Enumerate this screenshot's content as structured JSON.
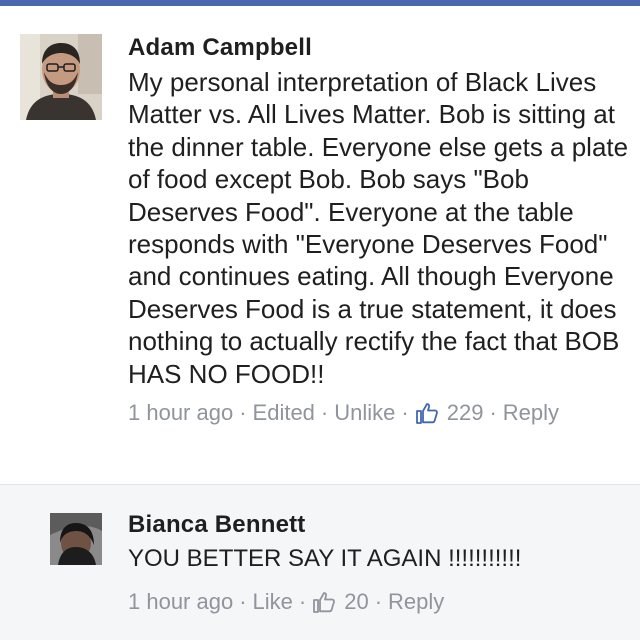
{
  "comments": [
    {
      "author": "Adam Campbell",
      "text": "My personal interpretation of Black Lives Matter vs. All Lives Matter. Bob is sitting at the dinner table. Everyone else gets a plate of food except Bob. Bob says \"Bob Deserves Food\". Everyone at the table responds with \"Everyone Deserves Food\" and continues eating. All though Everyone Deserves Food is a true statement, it does nothing to actually rectify the fact that BOB HAS NO FOOD!!",
      "time": "1 hour ago",
      "edited": "Edited",
      "like_action": "Unlike",
      "like_count": "229",
      "reply": "Reply"
    },
    {
      "author": "Bianca Bennett",
      "text": "YOU BETTER SAY IT AGAIN !!!!!!!!!!!",
      "time": "1 hour ago",
      "like_action": "Like",
      "like_count": "20",
      "reply": "Reply"
    }
  ],
  "icons": {
    "like": "thumbs-up-icon",
    "like_color_active": "#4267b2",
    "like_color": "#90949c",
    "accent": "#4a67ad"
  }
}
